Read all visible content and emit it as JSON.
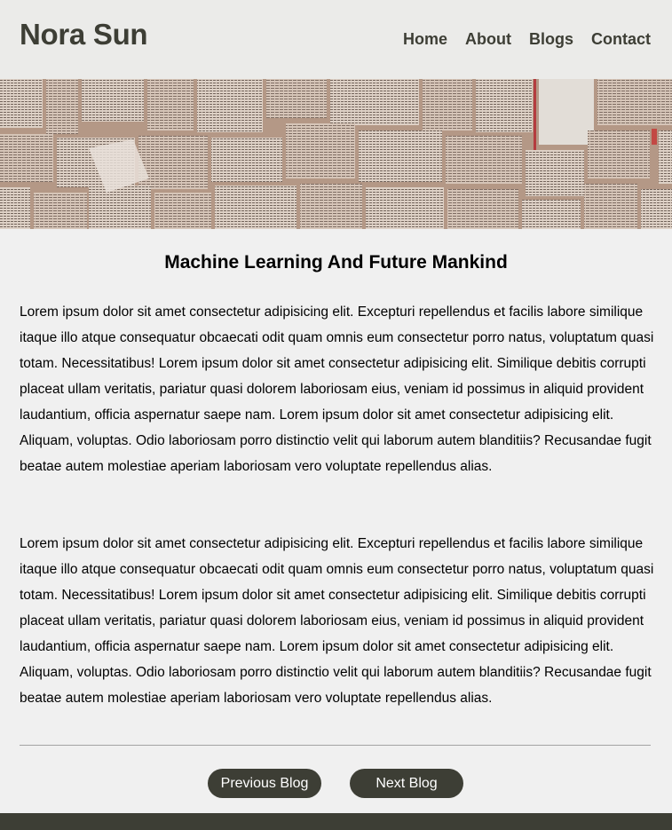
{
  "site": {
    "logo": "Nora Sun"
  },
  "nav": {
    "items": [
      {
        "label": "Home"
      },
      {
        "label": "About"
      },
      {
        "label": "Blogs"
      },
      {
        "label": "Contact"
      }
    ]
  },
  "hero": {
    "image": "open-books-banner-image"
  },
  "article": {
    "title": "Machine Learning And Future Mankind",
    "paragraphs": [
      "Lorem ipsum dolor sit amet consectetur adipisicing elit. Excepturi repellendus et facilis labore similique itaque illo atque consequatur obcaecati odit quam omnis eum consectetur porro natus, voluptatum quasi totam. Necessitatibus! Lorem ipsum dolor sit amet consectetur adipisicing elit. Similique debitis corrupti placeat ullam veritatis, pariatur quasi dolorem laboriosam eius, veniam id possimus in aliquid provident laudantium, officia aspernatur saepe nam. Lorem ipsum dolor sit amet consectetur adipisicing elit. Aliquam, voluptas. Odio laboriosam porro distinctio velit qui laborum autem blanditiis? Recusandae fugit beatae autem molestiae aperiam laboriosam vero voluptate repellendus alias.",
      "Lorem ipsum dolor sit amet consectetur adipisicing elit. Excepturi repellendus et facilis labore similique itaque illo atque consequatur obcaecati odit quam omnis eum consectetur porro natus, voluptatum quasi totam. Necessitatibus! Lorem ipsum dolor sit amet consectetur adipisicing elit. Similique debitis corrupti placeat ullam veritatis, pariatur quasi dolorem laboriosam eius, veniam id possimus in aliquid provident laudantium, officia aspernatur saepe nam. Lorem ipsum dolor sit amet consectetur adipisicing elit. Aliquam, voluptas. Odio laboriosam porro distinctio velit qui laborum autem blanditiis? Recusandae fugit beatae autem molestiae aperiam laboriosam vero voluptate repellendus alias."
    ]
  },
  "pagination": {
    "previous_label": "Previous Blog",
    "next_label": "Next Blog"
  },
  "colors": {
    "header_bg": "#ebebe9",
    "page_bg": "#f0f0f0",
    "brand_dark": "#3d3e35",
    "divider": "#a3a3a3"
  }
}
